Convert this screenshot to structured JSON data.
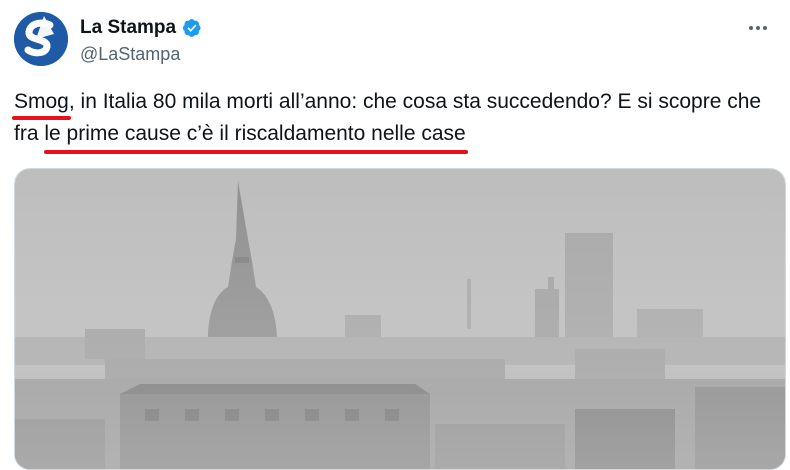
{
  "tweet": {
    "display_name": "La Stampa",
    "handle": "@LaStampa",
    "verified": true,
    "more_icon": "more-horizontal-icon",
    "avatar_icon": "la-stampa-logo",
    "text_parts": {
      "p1": "Smog",
      "p2": ", in Italia 80 mila morti all’anno: che cosa sta succedendo? E si scopre che fra ",
      "p3": "le prime cause c’è il riscaldamento nelle case"
    },
    "annotation_color": "#e8111b",
    "media_icon": "smog-turin-photo"
  },
  "colors": {
    "accent": "#1d9bf0",
    "brand": "#1f5aa6",
    "text": "#0f1419",
    "muted": "#536471"
  }
}
